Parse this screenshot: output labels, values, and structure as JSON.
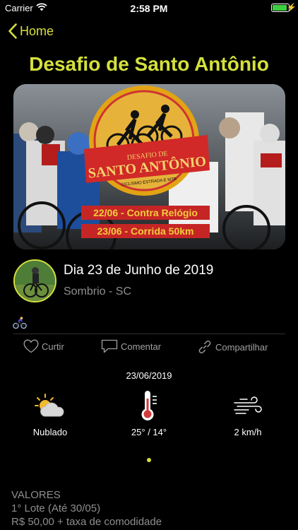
{
  "status_bar": {
    "carrier": "Carrier",
    "time": "2:58 PM",
    "battery_level_percent": 95
  },
  "nav": {
    "back_label": "Home",
    "accent_color": "#d5e03b"
  },
  "event": {
    "title": "Desafio de Santo Antônio",
    "date_line": "Dia 23 de Junho de 2019",
    "location": "Sombrio - SC",
    "category_icon": "cyclist-icon"
  },
  "banner": {
    "logo_line_1": "DESAFIO DE",
    "logo_line_2": "SANTO ANTÔNIO",
    "logo_line_3": "CICLISMO ESTRADA E MTB",
    "schedule": [
      "22/06 - Contra Relógio",
      "23/06 - Corrida 50km"
    ]
  },
  "actions": {
    "like_label": "Curtir",
    "comment_label": "Comentar",
    "share_label": "Compartilhar"
  },
  "weather": {
    "date": "23/06/2019",
    "condition": "Nublado",
    "temperature": "25° / 14°",
    "wind": "2 km/h"
  },
  "prices": {
    "heading": "VALORES",
    "lot_1": "1° Lote (Até 30/05)",
    "lot_1_price": "R$ 50,00 + taxa de comodidade"
  }
}
